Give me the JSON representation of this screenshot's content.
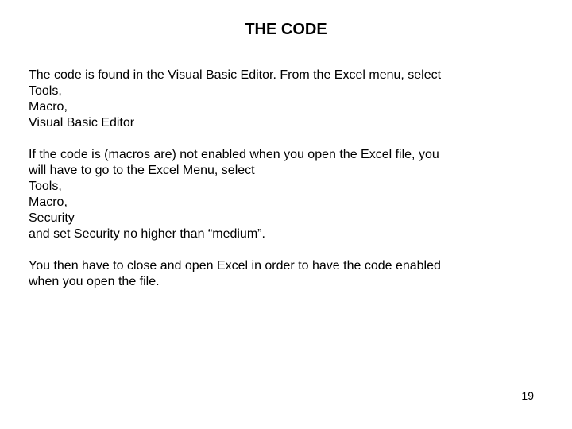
{
  "title": "THE CODE",
  "para1": {
    "l1": "The code is found in the Visual Basic Editor.  From the Excel menu, select",
    "l2": "Tools,",
    "l3": "Macro,",
    "l4": "Visual Basic Editor"
  },
  "para2": {
    "l1": "If the code is (macros are) not enabled when you open the Excel file, you",
    "l2": "will have to go to the Excel Menu, select",
    "l3": "Tools,",
    "l4": "Macro,",
    "l5": "Security",
    "l6": "and set Security no higher than “medium”."
  },
  "para3": {
    "l1": "You then have to close and open Excel in order to have the code enabled",
    "l2": "when you open the file."
  },
  "pageNumber": "19"
}
